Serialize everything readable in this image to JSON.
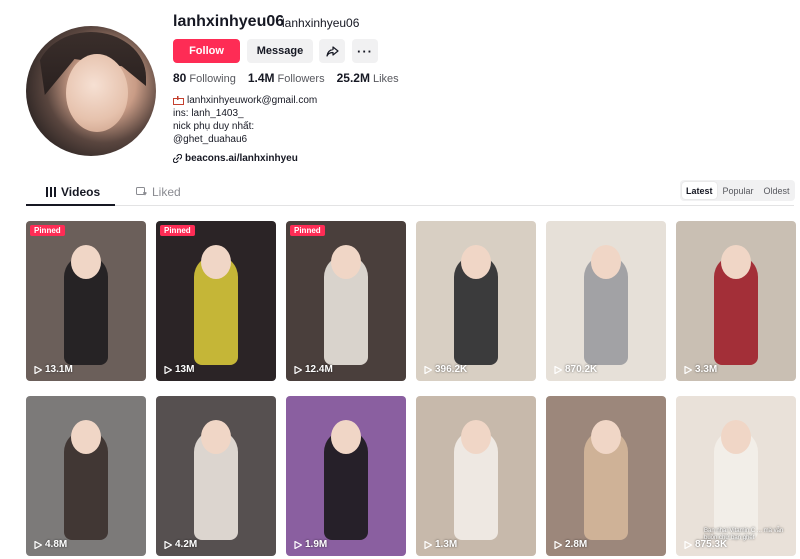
{
  "profile": {
    "username": "lanhxinhyeu06",
    "nickname": "lanhxinhyeu06",
    "follow_label": "Follow",
    "message_label": "Message",
    "share_icon": "share-icon",
    "more_icon": "more-icon",
    "more_glyph": "···",
    "accent": "#fe2c55"
  },
  "stats": {
    "following_count": "80",
    "following_label": "Following",
    "followers_count": "1.4M",
    "followers_label": "Followers",
    "likes_count": "25.2M",
    "likes_label": "Likes"
  },
  "bio": {
    "email": "lanhxinhyeuwork@gmail.com",
    "line2": "ins: lanh_1403_",
    "line3": "nick phụ duy nhất:",
    "line4": "@ghet_duahau6",
    "link": "beacons.ai/lanhxinhyeu"
  },
  "tabs": {
    "videos": "Videos",
    "liked": "Liked"
  },
  "sort": {
    "latest": "Latest",
    "popular": "Popular",
    "oldest": "Oldest"
  },
  "videos": [
    {
      "views": "13.1M",
      "pinned": "Pinned",
      "bg": "#6b5f5a",
      "fig": "#1f1d1f"
    },
    {
      "views": "13M",
      "pinned": "Pinned",
      "bg": "#2b2426",
      "fig": "#d6c63a"
    },
    {
      "views": "12.4M",
      "pinned": "Pinned",
      "bg": "#4a3f3c",
      "fig": "#e9e3dc"
    },
    {
      "views": "396.2K",
      "pinned": "",
      "bg": "#d8cfc3",
      "fig": "#2a2a2e"
    },
    {
      "views": "870.2K",
      "pinned": "",
      "bg": "#e6e0d8",
      "fig": "#9a9ba0"
    },
    {
      "views": "3.3M",
      "pinned": "",
      "bg": "#c9bfb3",
      "fig": "#9e1f2a"
    },
    {
      "views": "4.8M",
      "pinned": "",
      "bg": "#7c7a79",
      "fig": "#3b302c"
    },
    {
      "views": "4.2M",
      "pinned": "",
      "bg": "#565050",
      "fig": "#ebe3dd"
    },
    {
      "views": "1.9M",
      "pinned": "",
      "bg": "#8a5fa0",
      "fig": "#1b1a1c"
    },
    {
      "views": "1.3M",
      "pinned": "",
      "bg": "#c7b9ab",
      "fig": "#f2ede8"
    },
    {
      "views": "2.8M",
      "pinned": "",
      "bg": "#9c877b",
      "fig": "#d5b79a"
    },
    {
      "views": "875.3K",
      "pinned": "",
      "bg": "#e9e1d9",
      "fig": "#f3efe9",
      "caption": "Bạn nhai Vitamin C ... mà vẫn buồn chứ bạn ghét"
    }
  ]
}
